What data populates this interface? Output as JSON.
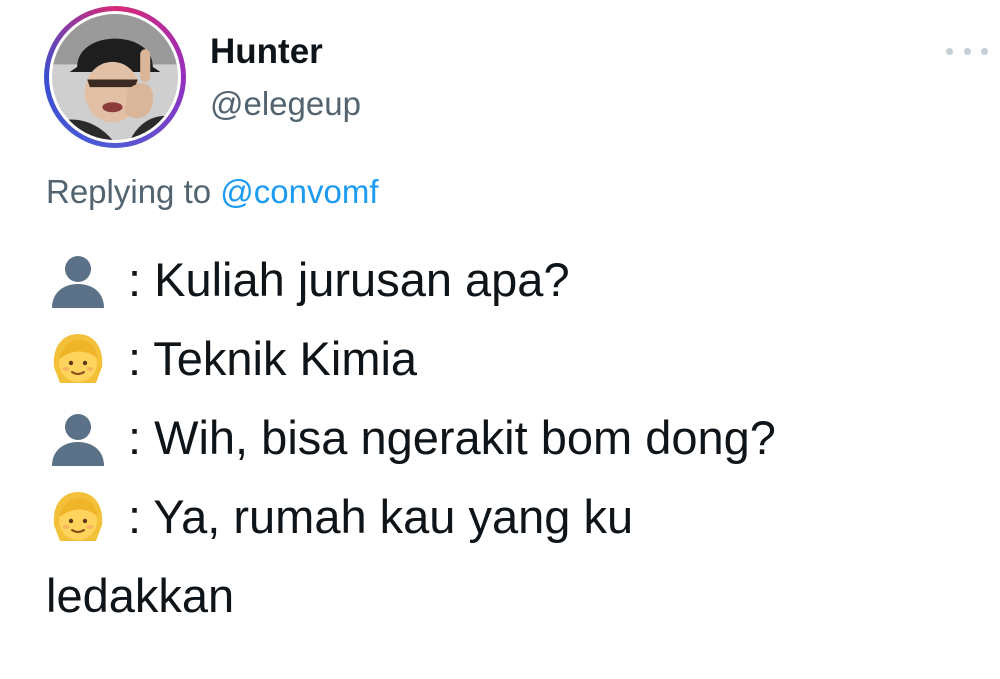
{
  "tweet": {
    "author": {
      "display_name": "Hunter",
      "handle": "@elegeup",
      "avatar_icon": "profile-photo"
    },
    "more_icon": "more-horizontal-icon",
    "reply_prefix": "Replying to",
    "reply_to": "@convomf",
    "lines": [
      {
        "speaker_icon": "bust-in-silhouette-emoji",
        "text": ": Kuliah jurusan apa?"
      },
      {
        "speaker_icon": "person-blond-hair-emoji",
        "text": ": Teknik Kimia"
      },
      {
        "speaker_icon": "bust-in-silhouette-emoji",
        "text": ": Wih, bisa ngerakit bom dong?"
      },
      {
        "speaker_icon": "person-blond-hair-emoji",
        "text": ": Ya, rumah kau yang ku"
      }
    ],
    "continuation": "ledakkan"
  },
  "colors": {
    "text": "#0f1419",
    "secondary": "#536471",
    "link": "#1d9bf0",
    "avatar_ring": [
      "#d62976",
      "#962fbf",
      "#4f5bd5"
    ]
  }
}
